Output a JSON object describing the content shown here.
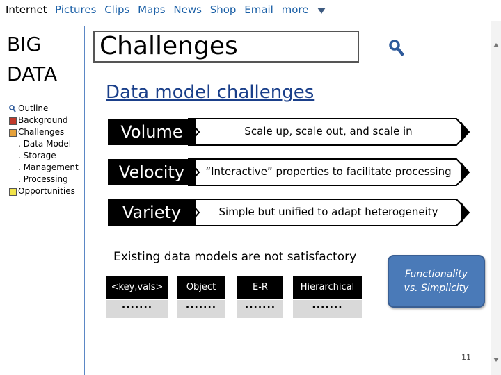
{
  "nav": {
    "brand": "Internet",
    "links": [
      "Pictures",
      "Clips",
      "Maps",
      "News",
      "Shop",
      "Email",
      "more"
    ]
  },
  "sidebar": {
    "title_line1": "BIG",
    "title_line2": "DATA",
    "outline": [
      {
        "label": "Outline",
        "marker": "magnifier-icon",
        "color": ""
      },
      {
        "label": "Background",
        "marker": "square",
        "color": "#c0392b"
      },
      {
        "label": "Challenges",
        "marker": "square",
        "color": "#e6a23c"
      },
      {
        "label": ". Data Model",
        "marker": "none",
        "color": ""
      },
      {
        "label": ". Storage",
        "marker": "none",
        "color": ""
      },
      {
        "label": ". Management",
        "marker": "none",
        "color": ""
      },
      {
        "label": ". Processing",
        "marker": "none",
        "color": ""
      },
      {
        "label": "Opportunities",
        "marker": "square",
        "color": "#f1e34a"
      }
    ]
  },
  "header": {
    "title": "Challenges",
    "subtitle": "Data model challenges"
  },
  "rows": [
    {
      "label": "Volume",
      "text": "Scale up, scale out, and scale in"
    },
    {
      "label": "Velocity",
      "text": "“Interactive” properties to facilitate processing"
    },
    {
      "label": "Variety",
      "text": "Simple but unified to adapt heterogeneity"
    }
  ],
  "existing": "Existing data models are not satisfactory",
  "models": [
    {
      "label": "<key,vals>",
      "dots": "·······"
    },
    {
      "label": "Object",
      "dots": "·······"
    },
    {
      "label": "E-R",
      "dots": "·······"
    },
    {
      "label": "Hierarchical",
      "dots": "·······"
    }
  ],
  "callout": {
    "line1": "Functionality",
    "line2": "vs. Simplicity"
  },
  "page_number": "11",
  "colors": {
    "accent": "#4a7ab8",
    "link": "#1a5fa6",
    "subtitle": "#1a3f8a"
  }
}
